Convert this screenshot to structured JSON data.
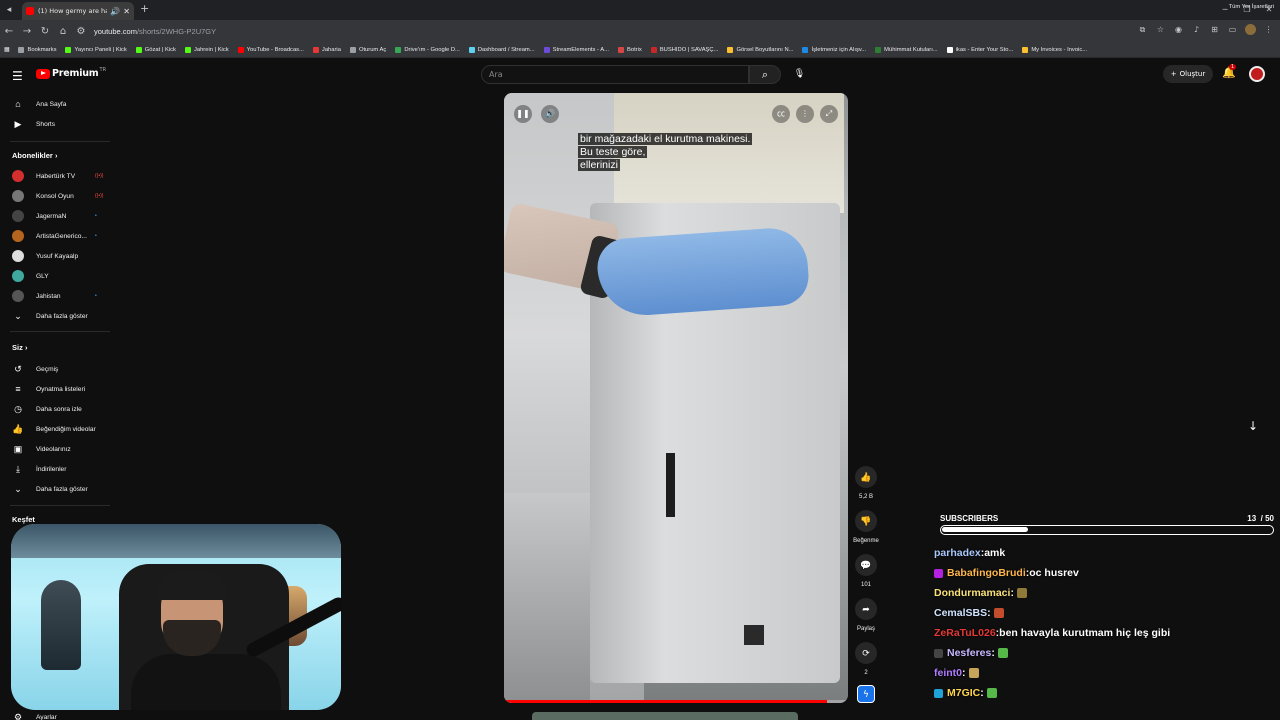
{
  "browser": {
    "tab_title": "(1) How germy are hand ai",
    "url_host": "youtube.com",
    "url_path": "/shorts/2WHG-P2U7GY",
    "bookmarks": [
      {
        "label": "Bookmarks",
        "color": "#9aa0a6"
      },
      {
        "label": "Yayıncı Paneli | Kick",
        "color": "#53fc18"
      },
      {
        "label": "Gözat | Kick",
        "color": "#53fc18"
      },
      {
        "label": "Jahrein | Kick",
        "color": "#53fc18"
      },
      {
        "label": "YouTube - Broadcas...",
        "color": "#ff0000"
      },
      {
        "label": "Jaharia",
        "color": "#e53935"
      },
      {
        "label": "Oturum Aç",
        "color": "#9aa0a6"
      },
      {
        "label": "Drive'ım - Google D...",
        "color": "#34a853"
      },
      {
        "label": "Dashboard / Stream...",
        "color": "#5fd0ef"
      },
      {
        "label": "StreamElements - A...",
        "color": "#6b4bd8"
      },
      {
        "label": "Botrix",
        "color": "#d64646"
      },
      {
        "label": "BUSHIDO | SAVAŞÇ...",
        "color": "#c62828"
      },
      {
        "label": "Görsel Boyutlarını N...",
        "color": "#fbc02d"
      },
      {
        "label": "İşletmeniz için Alışv...",
        "color": "#1e88e5"
      },
      {
        "label": "Mühimmat Kutuları...",
        "color": "#2e7d32"
      },
      {
        "label": "ikas - Enter Your Sto...",
        "color": "#ffffff"
      },
      {
        "label": "My Invoices - Invoic...",
        "color": "#fbc02d"
      }
    ],
    "all_bookmarks": "Tüm Yer İşaretleri"
  },
  "masthead": {
    "logo": "Premium",
    "logo_sup": "TR",
    "search_placeholder": "Ara",
    "create_label": "Oluştur",
    "notif_count": "1"
  },
  "sidebar": {
    "top": [
      {
        "label": "Ana Sayfa",
        "icon": "⌂"
      },
      {
        "label": "Shorts",
        "icon": "▶"
      }
    ],
    "subs_header": "Abonelikler",
    "channels": [
      {
        "label": "Habertürk TV",
        "color": "#d32f2f",
        "live": "((•))",
        "live_color": "#ff4e45"
      },
      {
        "label": "Konsol Oyun",
        "color": "#777777",
        "live": "((•))",
        "live_color": "#ff4e45"
      },
      {
        "label": "JagermaN",
        "color": "#444444",
        "live": "•",
        "live_color": "#3ea6ff"
      },
      {
        "label": "ArtistaGenerico...",
        "color": "#b5651d",
        "live": "•",
        "live_color": "#3ea6ff"
      },
      {
        "label": "Yusuf Kayaalp",
        "color": "#dddddd",
        "live": "",
        "live_color": "#3ea6ff"
      },
      {
        "label": "GLY",
        "color": "#3fa9a0",
        "live": "",
        "live_color": "#3ea6ff"
      },
      {
        "label": "Jahistan",
        "color": "#555555",
        "live": "•",
        "live_color": "#3ea6ff"
      }
    ],
    "show_more": "Daha fazla göster",
    "you_header": "Siz",
    "you_items": [
      {
        "label": "Geçmiş",
        "icon": "↺"
      },
      {
        "label": "Oynatma listeleri",
        "icon": "≡"
      },
      {
        "label": "Daha sonra izle",
        "icon": "◷"
      },
      {
        "label": "Beğendiğim videolar",
        "icon": "👍"
      },
      {
        "label": "Videolarınız",
        "icon": "▣"
      },
      {
        "label": "İndirilenler",
        "icon": "⤓"
      }
    ],
    "show_more_2": "Daha fazla göster",
    "explore_header": "Keşfet",
    "bottom_item": "Ayarlar"
  },
  "video": {
    "caption_lines": [
      "bir mağazadaki el kurutma makinesi.",
      "Bu teste göre,",
      "ellerinizi"
    ],
    "progress": 0.94
  },
  "actions": [
    {
      "name": "like",
      "icon": "👍",
      "label": "5,2 B"
    },
    {
      "name": "dislike",
      "icon": "👎",
      "label": "Beğenme"
    },
    {
      "name": "comments",
      "icon": "💬",
      "label": "101"
    },
    {
      "name": "share",
      "icon": "➦",
      "label": "Paylaş"
    },
    {
      "name": "remix",
      "icon": "⟳",
      "label": "2"
    }
  ],
  "subscribers": {
    "title": "SUBSCRIBERS",
    "current": 13,
    "goal": 50,
    "count_text": "13",
    "goal_text": "/ 50"
  },
  "chat": [
    {
      "user": "parhadex",
      "sep": " : ",
      "message": "amk",
      "color": "#a8c7fa",
      "badge": "",
      "emote": ""
    },
    {
      "user": "BabafingoBrudi",
      "sep": " : ",
      "message": "oc husrev",
      "color": "#ffb74d",
      "badge": "#b620e0",
      "emote": ""
    },
    {
      "user": "Dondurmamaci",
      "sep": " : ",
      "message": "",
      "color": "#f9e079",
      "badge": "",
      "emote": "#8f7a3a"
    },
    {
      "user": "CemalSBS",
      "sep": " : ",
      "message": "",
      "color": "#cfe3ff",
      "badge": "",
      "emote": "#c24d2c"
    },
    {
      "user": "ZeRaTuL026",
      "sep": " : ",
      "message": "ben havayla kurutmam hiç leş gibi",
      "color": "#e53935",
      "badge": "",
      "emote": ""
    },
    {
      "user": "Nesferes",
      "sep": " : ",
      "message": "",
      "color": "#c6b8ff",
      "badge": "#444444",
      "emote": "#56b849"
    },
    {
      "user": "feint0",
      "sep": " : ",
      "message": "",
      "color": "#b07cff",
      "badge": "",
      "emote": "#c8a35a"
    },
    {
      "user": "M7GIC",
      "sep": " : ",
      "message": "",
      "color": "#ffd54f",
      "badge": "#1fa2d8",
      "emote": "#56b849"
    }
  ]
}
